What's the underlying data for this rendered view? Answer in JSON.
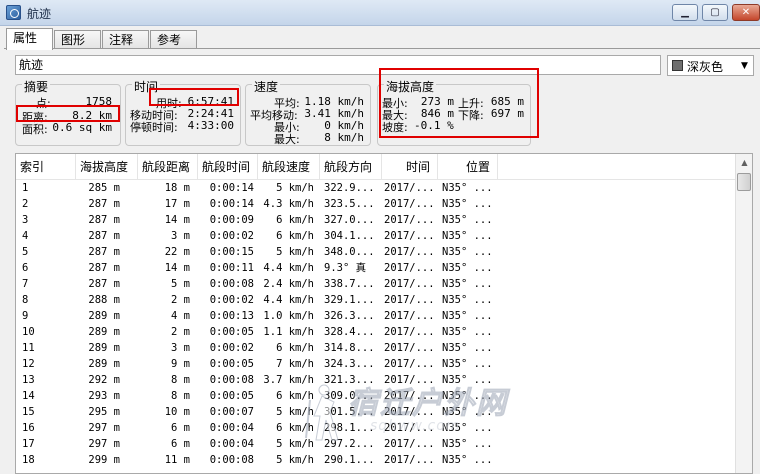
{
  "window": {
    "title": "航迹",
    "controls": {
      "minimize": "▁",
      "maximize": "▢",
      "close": "✕"
    }
  },
  "tabs": [
    {
      "label": "属性",
      "active": true
    },
    {
      "label": "图形",
      "active": false
    },
    {
      "label": "注释",
      "active": false
    },
    {
      "label": "参考",
      "active": false
    }
  ],
  "track_name": "航迹",
  "color": {
    "label": "深灰色",
    "swatch": "#6e6e6e"
  },
  "summary": {
    "title": "摘要",
    "points_label": "点:",
    "points_value": "1758",
    "distance_label": "距离:",
    "distance_value": "8.2 km",
    "area_label": "面积:",
    "area_value": "0.6 sq km"
  },
  "time": {
    "title": "时间",
    "elapsed_label": "用时:",
    "elapsed_value": "6:57:41",
    "moving_label": "移动时间:",
    "moving_value": "2:24:41",
    "stopped_label": "停顿时间:",
    "stopped_value": "4:33:00"
  },
  "speed": {
    "title": "速度",
    "avg_label": "平均:",
    "avg_value": "1.18 km/h",
    "moving_avg_label": "平均移动:",
    "moving_avg_value": "3.41 km/h",
    "min_label": "最小:",
    "min_value": "0 km/h",
    "max_label": "最大:",
    "max_value": "8 km/h"
  },
  "altitude": {
    "title": "海拔高度",
    "min_label": "最小:",
    "min_value": "273 m",
    "ascent_label": "上升:",
    "ascent_value": "685 m",
    "max_label": "最大:",
    "max_value": "846 m",
    "descent_label": "下降:",
    "descent_value": "697 m",
    "grade_label": "坡度:",
    "grade_value": "-0.1 %"
  },
  "table": {
    "columns": [
      "索引",
      "海拔高度",
      "航段距离",
      "航段时间",
      "航段速度",
      "航段方向",
      "时间",
      "位置"
    ],
    "rows": [
      [
        "1",
        "285 m",
        "18 m",
        "0:00:14",
        "5 km/h",
        "322.9...",
        "2017/...",
        "N35° ..."
      ],
      [
        "2",
        "287 m",
        "17 m",
        "0:00:14",
        "4.3 km/h",
        "323.5...",
        "2017/...",
        "N35° ..."
      ],
      [
        "3",
        "287 m",
        "14 m",
        "0:00:09",
        "6 km/h",
        "327.0...",
        "2017/...",
        "N35° ..."
      ],
      [
        "4",
        "287 m",
        "3 m",
        "0:00:02",
        "6 km/h",
        "304.1...",
        "2017/...",
        "N35° ..."
      ],
      [
        "5",
        "287 m",
        "22 m",
        "0:00:15",
        "5 km/h",
        "348.0...",
        "2017/...",
        "N35° ..."
      ],
      [
        "6",
        "287 m",
        "14 m",
        "0:00:11",
        "4.4 km/h",
        "9.3° 真",
        "2017/...",
        "N35° ..."
      ],
      [
        "7",
        "287 m",
        "5 m",
        "0:00:08",
        "2.4 km/h",
        "338.7...",
        "2017/...",
        "N35° ..."
      ],
      [
        "8",
        "288 m",
        "2 m",
        "0:00:02",
        "4.4 km/h",
        "329.1...",
        "2017/...",
        "N35° ..."
      ],
      [
        "9",
        "289 m",
        "4 m",
        "0:00:13",
        "1.0 km/h",
        "326.3...",
        "2017/...",
        "N35° ..."
      ],
      [
        "10",
        "289 m",
        "2 m",
        "0:00:05",
        "1.1 km/h",
        "328.4...",
        "2017/...",
        "N35° ..."
      ],
      [
        "11",
        "289 m",
        "3 m",
        "0:00:02",
        "6 km/h",
        "314.8...",
        "2017/...",
        "N35° ..."
      ],
      [
        "12",
        "289 m",
        "9 m",
        "0:00:05",
        "7 km/h",
        "324.3...",
        "2017/...",
        "N35° ..."
      ],
      [
        "13",
        "292 m",
        "8 m",
        "0:00:08",
        "3.7 km/h",
        "321.3...",
        "2017/...",
        "N35° ..."
      ],
      [
        "14",
        "293 m",
        "8 m",
        "0:00:05",
        "6 km/h",
        "309.0...",
        "2017/...",
        "N35° ..."
      ],
      [
        "15",
        "295 m",
        "10 m",
        "0:00:07",
        "5 km/h",
        "301.5...",
        "2017/...",
        "N35° ..."
      ],
      [
        "16",
        "297 m",
        "6 m",
        "0:00:04",
        "6 km/h",
        "298.1...",
        "2017/...",
        "N35° ..."
      ],
      [
        "17",
        "297 m",
        "6 m",
        "0:00:04",
        "5 km/h",
        "297.2...",
        "2017/...",
        "N35° ..."
      ],
      [
        "18",
        "299 m",
        "11 m",
        "0:00:08",
        "5 km/h",
        "290.1...",
        "2017/...",
        "N35° ..."
      ]
    ]
  },
  "watermark": {
    "text": "宿迁户外网",
    "sub": "sqhww.com"
  }
}
